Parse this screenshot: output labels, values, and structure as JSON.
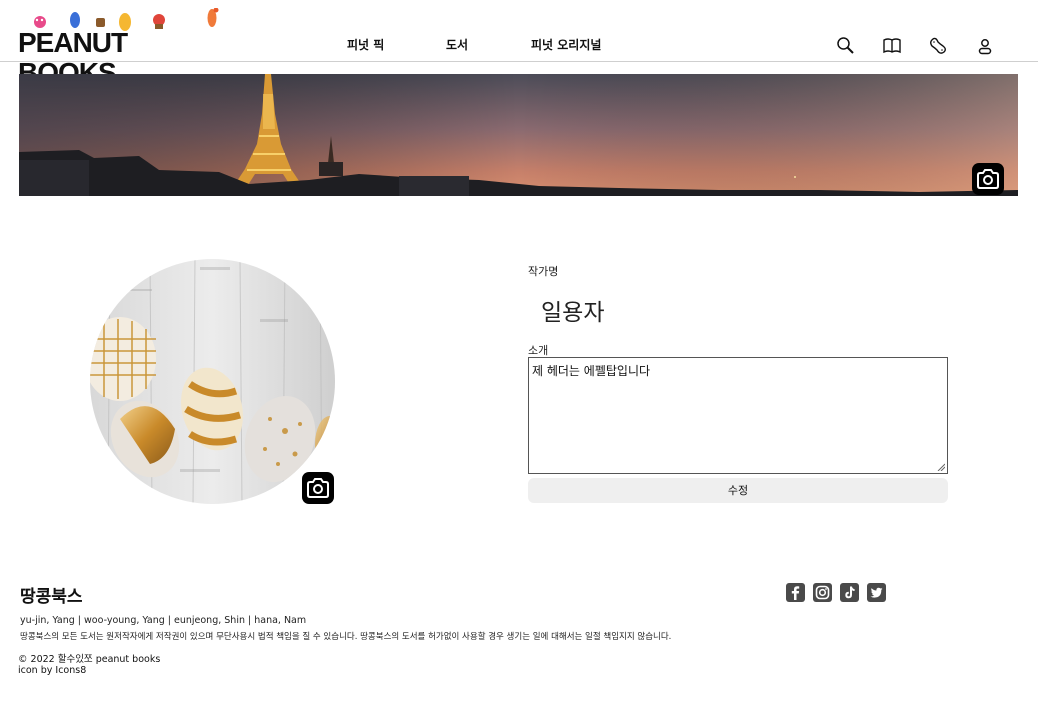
{
  "header": {
    "logo_text": "PEANUT BOOKS",
    "nav": [
      {
        "label": "피넛 픽"
      },
      {
        "label": "도서"
      },
      {
        "label": "피넛 오리지널"
      }
    ],
    "icons": [
      "search-icon",
      "book-icon",
      "peanut-icon",
      "user-icon"
    ]
  },
  "profile": {
    "author_label": "작가명",
    "author_name": "일용자",
    "bio_label": "소개",
    "bio_value": "제 헤더는 에펠탑입니다",
    "edit_label": "수정"
  },
  "footer": {
    "title": "땅콩북스",
    "team": "yu-jin, Yang  |  woo-young, Yang  |  eunjeong, Shin  |  hana, Nam",
    "notice": "땅콩북스의 모든 도서는 원저작자에게 저작권이 있으며 무단사용시 법적 책임을 질 수 있습니다. 땅콩북스의 도서를 허가없이 사용할 경우 생기는 일에 대해서는 일절 책임지지 않습니다.",
    "copyright": "© 2022 할수있쪼 peanut books",
    "icon_credit": "icon by Icons8",
    "social": [
      "facebook-icon",
      "instagram-icon",
      "tiktok-icon",
      "twitter-icon"
    ]
  },
  "colors": {
    "accent_button": "#efefef",
    "camera_button": "#000000",
    "social_icon": "#4a4a4a"
  }
}
